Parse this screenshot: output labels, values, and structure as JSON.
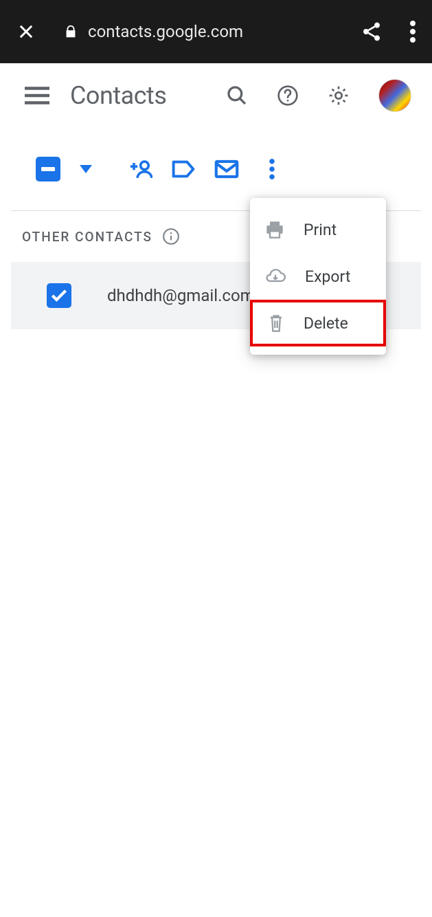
{
  "browser": {
    "url": "contacts.google.com"
  },
  "app": {
    "title": "Contacts"
  },
  "section": {
    "title": "OTHER CONTACTS"
  },
  "contacts": [
    {
      "email": "dhdhdh@gmail.com"
    }
  ],
  "menu": {
    "items": [
      {
        "label": "Print",
        "icon": "printer-icon"
      },
      {
        "label": "Export",
        "icon": "cloud-download-icon"
      },
      {
        "label": "Delete",
        "icon": "trash-icon"
      }
    ]
  }
}
